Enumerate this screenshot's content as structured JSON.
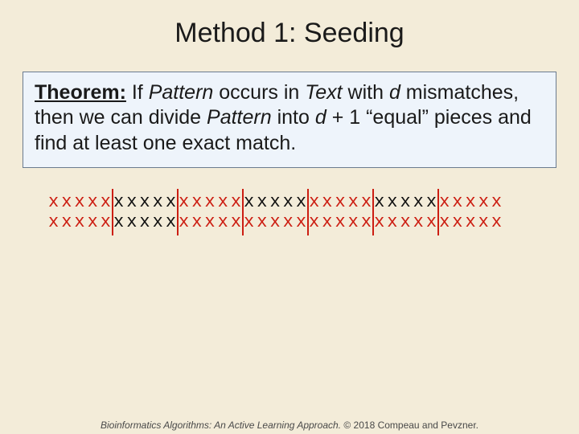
{
  "title": "Method 1: Seeding",
  "theorem": {
    "label": "Theorem:",
    "part1_plain": " If ",
    "part1_pattern": "Pattern",
    "part2_plain": " occurs in ",
    "part2_text": "Text",
    "part3_plain": " with ",
    "part3_d": "d",
    "part4_plain": " mismatches, then we can divide ",
    "part4_pattern": "Pattern",
    "part5_plain": " into ",
    "part5_d": "d",
    "part6_plain": " + 1 “equal” pieces and find at least one exact match."
  },
  "sequence": {
    "num_pieces": 7,
    "piece_len": 5,
    "row1": [
      {
        "text": "xxxxx",
        "cls": "red"
      },
      {
        "text": "xxxxx",
        "cls": "blk"
      },
      {
        "text": "xxxxx",
        "cls": "red"
      },
      {
        "text": "xxxxx",
        "cls": "blk"
      },
      {
        "text": "xxxxx",
        "cls": "red"
      },
      {
        "text": "xxxxx",
        "cls": "blk"
      },
      {
        "text": "xxxxx",
        "cls": "red"
      }
    ],
    "row2": [
      {
        "text": "xxxxx",
        "cls": "red"
      },
      {
        "text": "xxxxx",
        "cls": "blk"
      },
      {
        "text": "xxxxxxxxxxxxxxxxxxxxxxxxx",
        "cls": "red"
      }
    ]
  },
  "footer": {
    "book": "Bioinformatics Algorithms: An Active Learning Approach.",
    "copyright": " © 2018 Compeau and Pevzner."
  }
}
